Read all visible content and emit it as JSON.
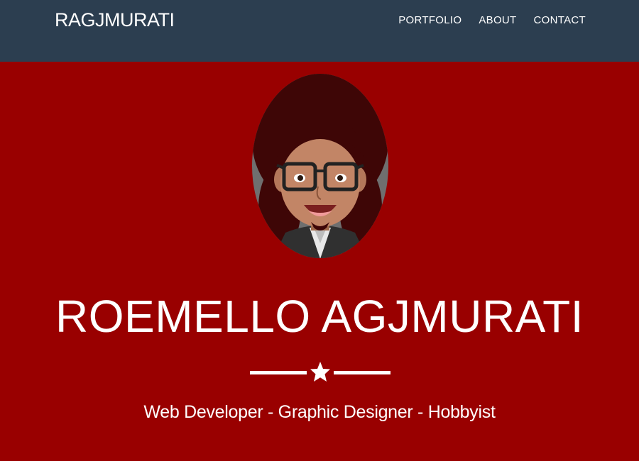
{
  "navbar": {
    "brand": "RAGJMURATI",
    "links": [
      "PORTFOLIO",
      "ABOUT",
      "CONTACT"
    ]
  },
  "hero": {
    "name": "ROEMELLO AGJMURATI",
    "tagline": "Web Developer - Graphic Designer - Hobbyist",
    "divider_icon": "star-icon"
  },
  "colors": {
    "navbar_bg": "#2c3e50",
    "hero_bg": "#990000",
    "text": "#ffffff"
  }
}
